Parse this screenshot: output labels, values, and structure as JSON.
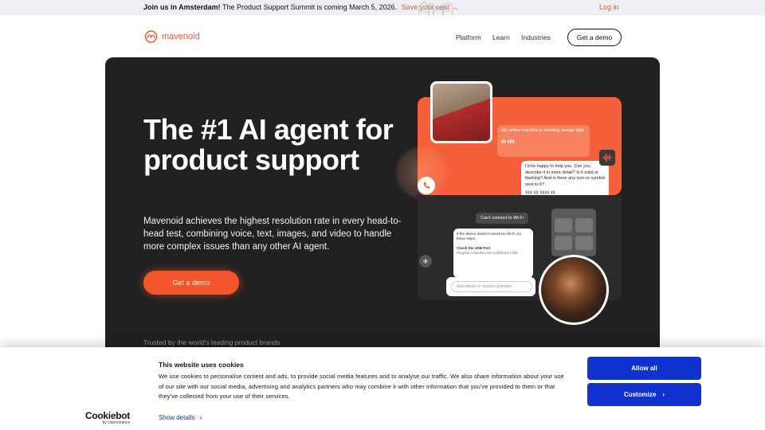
{
  "announcement": {
    "lead": "Join us in Amsterdam!",
    "text": "The Product Support Summit is coming March 5, 2026.",
    "link": "Save your seat →",
    "login": "Log in"
  },
  "nav": {
    "logo_text": "mavenoid",
    "links": [
      "Platform",
      "Learn",
      "Industries"
    ],
    "demo_label": "Get a demo"
  },
  "hero": {
    "title": "The #1 AI agent for product support",
    "subtitle": "Mavenoid achieves the highest resolution rate in every head-to-head test, combining voice, text, images, and video to handle more complex issues than any other AI agent.",
    "cta_label": "Get a demo",
    "trusted": "Trusted by the world's leading product brands"
  },
  "illustration": {
    "user_message": "My coffee machine is showing orange light",
    "agent_message": "I'd be happy to help you. Can you describe it in more detail? Is it solid or flashing? And is there any icon or symbol next to it?",
    "chip_label": "Can't connect to Wi-Fi",
    "steps_intro": "If the device doesn't connect to Wi-Fi, try these steps:",
    "step_title": "Check the USB Port",
    "step_detail": "Plug the controller into a different USB",
    "input_placeholder": "Add details or another question"
  },
  "cookie": {
    "brand": "Cookiebot",
    "brand_by": "by Usercentrics",
    "title": "This website uses cookies",
    "body": "We use cookies to personalise content and ads, to provide social media features and to analyse our traffic. We also share information about your use of our site with our social media, advertising and analytics partners who may combine it with other information that you've provided to them or that they've collected from your use of their services.",
    "details_label": "Show details",
    "allow_label": "Allow all",
    "customize_label": "Customize"
  },
  "colors": {
    "accent": "#f2552c",
    "hero_bg": "#212121",
    "cookie_button": "#1032cf"
  }
}
